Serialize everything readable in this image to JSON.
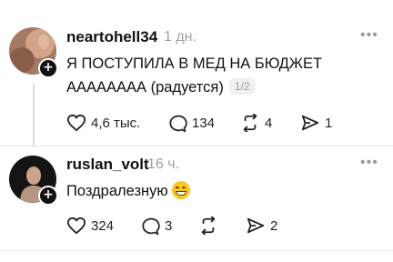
{
  "posts": [
    {
      "username": "neartohell34",
      "time": "1 дн.",
      "text_line1": "Я ПОСТУПИЛА В МЕД НА БЮДЖЕТ",
      "text_line2": "АААААААА (радуется)",
      "pager": "1/2",
      "likes": "4,6 тыс.",
      "replies": "134",
      "reposts": "4",
      "shares": "1"
    },
    {
      "username": "ruslan_volt",
      "time": "16 ч.",
      "text": "Поздралезную",
      "emoji": "grinning-face-emoji",
      "likes": "324",
      "replies": "3",
      "reposts": "",
      "shares": "2"
    }
  ],
  "icons": {
    "more": "more-icon",
    "like": "heart-icon",
    "reply": "comment-icon",
    "repost": "repost-icon",
    "share": "share-icon",
    "follow": "plus-icon"
  },
  "colors": {
    "text": "#111111",
    "muted": "#a0a0a0",
    "divider": "#e6e6e6"
  }
}
